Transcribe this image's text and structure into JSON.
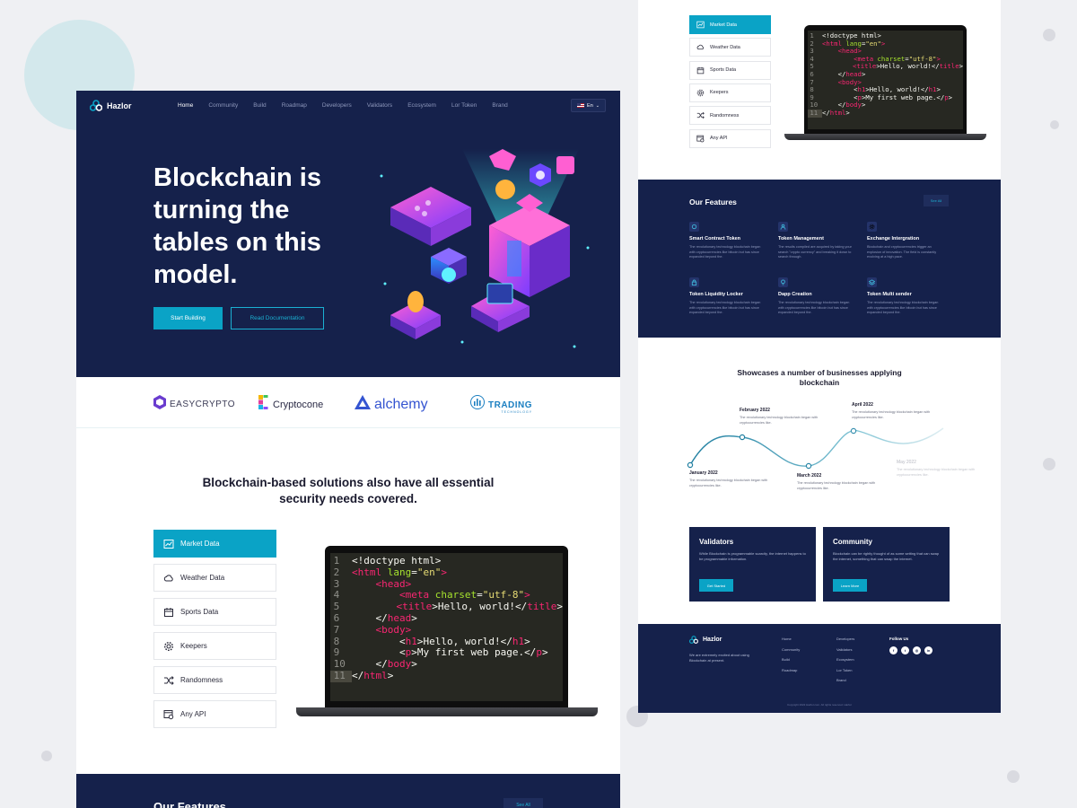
{
  "brand": {
    "name": "Hazlor"
  },
  "nav": {
    "links": [
      "Home",
      "Community",
      "Build",
      "Roadmap",
      "Developers",
      "Validators",
      "Ecosystem",
      "Lor Token",
      "Brand"
    ],
    "active": "Home",
    "lang": "En"
  },
  "hero": {
    "title": "Blockchain is turning the tables on this model.",
    "primary_button": "Start Building",
    "secondary_button": "Read Documentation"
  },
  "partners": [
    {
      "name": "EASYCRYPTO",
      "icon": "easycrypto-logo"
    },
    {
      "name": "Cryptocone",
      "icon": "cryptocone-logo"
    },
    {
      "name": "alchemy",
      "icon": "alchemy-logo"
    },
    {
      "name": "TRADING",
      "sub": "TECHNOLOGY",
      "icon": "trading-technology-logo"
    }
  ],
  "solutions": {
    "title": "Blockchain-based solutions also have all essential security needs covered.",
    "tabs": [
      {
        "label": "Market Data",
        "icon": "chart-icon",
        "active": true
      },
      {
        "label": "Weather Data",
        "icon": "cloud-icon",
        "active": false
      },
      {
        "label": "Sports Data",
        "icon": "calendar-icon",
        "active": false
      },
      {
        "label": "Keepers",
        "icon": "gear-icon",
        "active": false
      },
      {
        "label": "Randomness",
        "icon": "shuffle-icon",
        "active": false
      },
      {
        "label": "Any API",
        "icon": "api-icon",
        "active": false
      }
    ]
  },
  "code": {
    "lines": [
      [
        [
          "plain",
          "<!doctype html>"
        ]
      ],
      [
        [
          "tag",
          "<html"
        ],
        [
          "attr",
          " lang"
        ],
        [
          "plain",
          "="
        ],
        [
          "str",
          "\"en\""
        ],
        [
          "tag",
          ">"
        ]
      ],
      [
        [
          "plain",
          "    "
        ],
        [
          "tag",
          "<head>"
        ]
      ],
      [
        [
          "plain",
          "        "
        ],
        [
          "tag",
          "<meta"
        ],
        [
          "attr",
          " charset"
        ],
        [
          "plain",
          "="
        ],
        [
          "str",
          "\"utf-8\""
        ],
        [
          "tag",
          ">"
        ]
      ],
      [
        [
          "plain",
          "        "
        ],
        [
          "tag",
          "<title"
        ],
        [
          "plain",
          ">Hello, world!</"
        ],
        [
          "tag",
          "title"
        ],
        [
          "plain",
          ">"
        ]
      ],
      [
        [
          "plain",
          "    </"
        ],
        [
          "tag",
          "head"
        ],
        [
          "plain",
          ">"
        ]
      ],
      [
        [
          "plain",
          "    "
        ],
        [
          "tag",
          "<body>"
        ]
      ],
      [
        [
          "plain",
          "        <"
        ],
        [
          "tag",
          "h1"
        ],
        [
          "plain",
          ">Hello, world!</"
        ],
        [
          "tag",
          "h1"
        ],
        [
          "plain",
          ">"
        ]
      ],
      [
        [
          "plain",
          "        <"
        ],
        [
          "tag",
          "p"
        ],
        [
          "plain",
          ">My first web page.</"
        ],
        [
          "tag",
          "p"
        ],
        [
          "plain",
          ">"
        ]
      ],
      [
        [
          "plain",
          "    </"
        ],
        [
          "tag",
          "body"
        ],
        [
          "plain",
          ">"
        ]
      ],
      [
        [
          "plain",
          "</"
        ],
        [
          "tag",
          "html"
        ],
        [
          "plain",
          ">"
        ]
      ]
    ],
    "highlight_line": 11
  },
  "bottom_band": {
    "title": "Our Features",
    "button": "See All"
  },
  "features": {
    "title": "Our Features",
    "button": "See All",
    "items": [
      {
        "name": "Smart Contract Token",
        "desc": "The revolutionary technology blockchain began with cryptocurrencies like bitcoin but has since expanded beyond the.",
        "icon": "settings-icon"
      },
      {
        "name": "Token Management",
        "desc": "The results compiled are acquired by taking your search \"crypto currency\" and breaking it down to search through.",
        "icon": "user-icon"
      },
      {
        "name": "Exchange Intergration",
        "desc": "Blockchain and cryptocurrencies trigger an explosion of innovation. The field is constantly evolving at a high pace.",
        "icon": "gear-icon"
      },
      {
        "name": "Token Liquidity Locker",
        "desc": "The revolutionary technology blockchain began with cryptocurrencies like bitcoin but has since expanded beyond the.",
        "icon": "lock-icon"
      },
      {
        "name": "Dapp Creation",
        "desc": "The revolutionary technology blockchain began with cryptocurrencies like bitcoin but has since expanded beyond the.",
        "icon": "bulb-icon"
      },
      {
        "name": "Token Multi sender",
        "desc": "The revolutionary technology blockchain began with cryptocurrencies like bitcoin but has since expanded beyond the.",
        "icon": "layers-icon"
      }
    ]
  },
  "showcase": {
    "title": "Showcases a number of businesses applying blockchain",
    "milestones": [
      {
        "month": "January 2022",
        "desc": "The revolutionary technology blockchain began with cryptocurrencies like.",
        "faded": false
      },
      {
        "month": "February 2022",
        "desc": "The revolutionary technology blockchain began with cryptocurrencies like.",
        "faded": false
      },
      {
        "month": "March 2022",
        "desc": "The revolutionary technology blockchain began with cryptocurrencies like.",
        "faded": false
      },
      {
        "month": "April 2022",
        "desc": "The revolutionary technology blockchain began with cryptocurrencies like.",
        "faded": false
      },
      {
        "month": "May 2022",
        "desc": "The revolutionary technology blockchain began with cryptocurrencies like.",
        "faded": true
      }
    ]
  },
  "cards": [
    {
      "title": "Validators",
      "desc": "While Blockchain is programmable scarcity, the internet happens to be programmable information.",
      "button": "Get Started"
    },
    {
      "title": "Community",
      "desc": "Blockchain can be rightly thought of as some setting that can swap the internet, something that can swap the internet.",
      "button": "Learn More"
    }
  ],
  "footer": {
    "about": "We are extremely excited about using Blockchain at present.",
    "col1": [
      "Home",
      "Community",
      "Build",
      "Roadmap"
    ],
    "col2": [
      "Developers",
      "Validators",
      "Ecosystem",
      "Lor Token",
      "Brand"
    ],
    "follow_label": "Follow Us",
    "socials": [
      {
        "icon": "facebook-icon",
        "glyph": "f"
      },
      {
        "icon": "twitter-icon",
        "glyph": "t"
      },
      {
        "icon": "instagram-icon",
        "glyph": "◎"
      },
      {
        "icon": "linkedin-icon",
        "glyph": "in"
      }
    ],
    "copyright": "Copyright 2022 Hazlor.com. All rights reserved. Hazlor"
  },
  "colors": {
    "navy": "#15214b",
    "accent": "#0aa3c6",
    "bg": "#eff0f3"
  }
}
